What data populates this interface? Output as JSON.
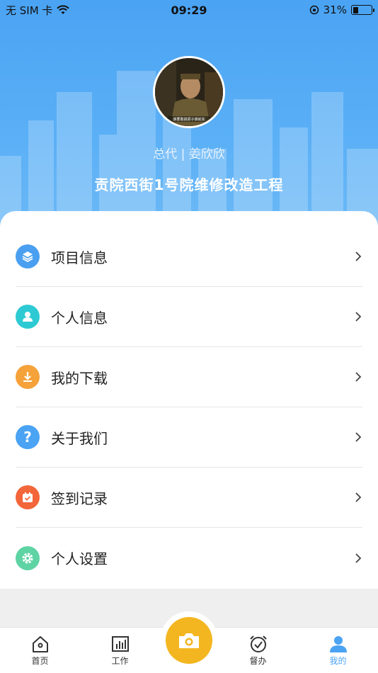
{
  "status_bar": {
    "carrier": "无 SIM 卡",
    "time": "09:29",
    "battery_percent": "31%",
    "battery_level": 0.31
  },
  "profile": {
    "role_line": "总代 | 姜欣欣",
    "project_title": "贡院西街1号院维修改造工程",
    "avatar_caption": "谁要敢挑梁子谁就完"
  },
  "menu": {
    "items": [
      {
        "label": "项目信息",
        "icon": "layers-icon",
        "color": "#4a9ff0"
      },
      {
        "label": "个人信息",
        "icon": "person-icon",
        "color": "#2ecad4"
      },
      {
        "label": "我的下载",
        "icon": "download-icon",
        "color": "#f5a23a"
      },
      {
        "label": "关于我们",
        "icon": "question-icon",
        "color": "#4aa3f3"
      },
      {
        "label": "签到记录",
        "icon": "calendar-check-icon",
        "color": "#f2663a"
      },
      {
        "label": "个人设置",
        "icon": "settings-gear-icon",
        "color": "#5ed3a4"
      }
    ]
  },
  "tabbar": {
    "tabs": [
      {
        "label": "首页",
        "icon": "home-icon"
      },
      {
        "label": "工作",
        "icon": "chart-icon"
      },
      {
        "label": "督办",
        "icon": "alarm-icon"
      },
      {
        "label": "我的",
        "icon": "user-icon",
        "active": true
      }
    ],
    "camera_icon": "camera-icon"
  },
  "colors": {
    "header": "#4aa3f3",
    "accent": "#f4b620",
    "active_tab": "#4aa3f3"
  }
}
